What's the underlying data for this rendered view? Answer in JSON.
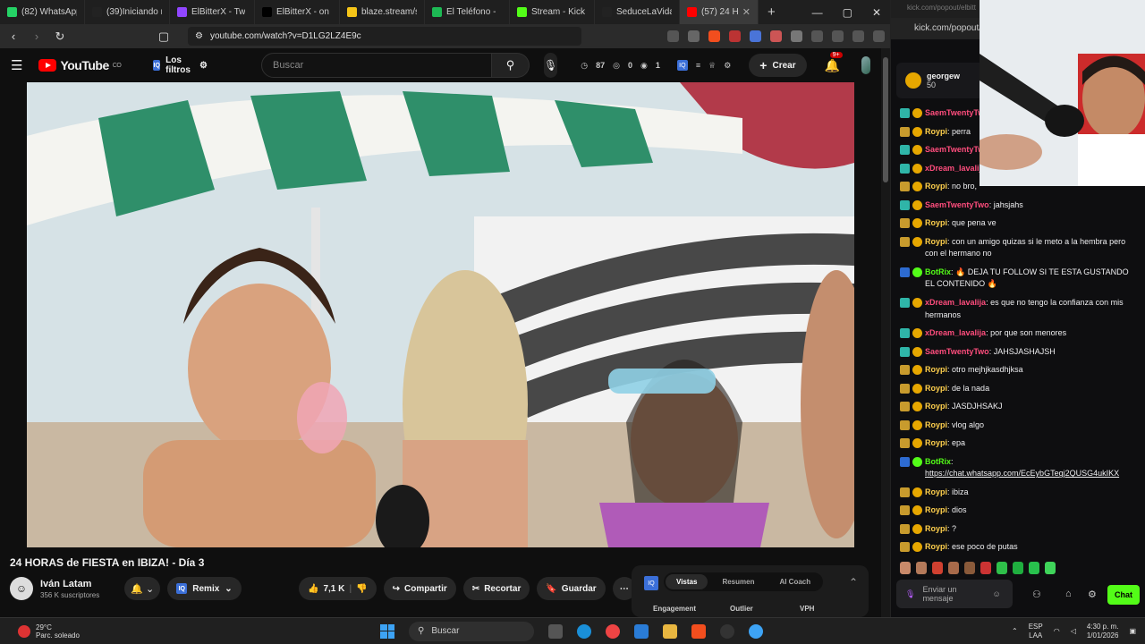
{
  "browser": {
    "tabs": [
      {
        "label": "(82) WhatsApp",
        "color": "#25d366",
        "active": false
      },
      {
        "label": "(39)Iniciando mi",
        "color": "#222222",
        "active": false
      },
      {
        "label": "ElBitterX - Tw",
        "color": "#9146ff",
        "active": false
      },
      {
        "label": "ElBitterX - on X",
        "color": "#000000",
        "active": false
      },
      {
        "label": "blaze.stream/stre",
        "color": "#f5c518",
        "active": false
      },
      {
        "label": "El Teléfono -",
        "color": "#1db954",
        "active": false
      },
      {
        "label": "Stream - Kick",
        "color": "#53fc18",
        "active": false
      },
      {
        "label": "SeduceLaVida (@",
        "color": "#222222",
        "active": false
      },
      {
        "label": "(57) 24 H",
        "color": "#ff0000",
        "active": true
      }
    ],
    "new_tab": "+",
    "url": "youtube.com/watch?v=D1LG2LZ4E9c"
  },
  "youtube": {
    "logo_text": "YouTube",
    "logo_sup": "CO",
    "filters_label": "Los filtros",
    "search_placeholder": "Buscar",
    "stats": [
      "87",
      "0",
      "1"
    ],
    "create_label": "Crear",
    "notif_badge": "9+",
    "video": {
      "title": "24 HORAS de FIESTA en IBIZA! - Día 3",
      "channel": "Iván Latam",
      "subscribers": "356 K suscriptores",
      "likes": "7,1 K",
      "remix_label": "Remix",
      "share_label": "Compartir",
      "clip_label": "Recortar",
      "save_label": "Guardar"
    },
    "iq_panel": {
      "tabs": [
        "Vistas",
        "Resumen",
        "AI Coach"
      ],
      "active_tab": "Vistas",
      "columns": [
        "Engagement",
        "Outlier",
        "VPH"
      ]
    }
  },
  "kick": {
    "url_faint": "kick.com/popout/elbitt",
    "url": "kick.com/popout/",
    "pinned_user": "georgew",
    "pinned_amount": "50",
    "messages": [
      {
        "user": "SaemTwentyTwo",
        "text": "",
        "color": "#ff4d7d"
      },
      {
        "user": "Roypi",
        "text": "perra",
        "color": "#ffd04d"
      },
      {
        "user": "SaemTwentyTwo",
        "text": "",
        "color": "#ff4d7d"
      },
      {
        "user": "xDream_lavalija",
        "text": "",
        "color": "#ff4d7d"
      },
      {
        "user": "Roypi",
        "text": "no bro,",
        "color": "#ffd04d"
      },
      {
        "user": "SaemTwentyTwo",
        "text": "jahsjahs",
        "color": "#ff4d7d"
      },
      {
        "user": "Roypi",
        "text": "que pena ve",
        "color": "#ffd04d"
      },
      {
        "user": "Roypi",
        "text": "con un amigo quizas si le meto a la hembra pero con el hermano no",
        "color": "#ffd04d"
      },
      {
        "user": "BotRix",
        "text": "🔥 DEJA TU FOLLOW SI TE ESTA GUSTANDO EL CONTENIDO 🔥",
        "color": "#53fc18"
      },
      {
        "user": "xDream_lavalija",
        "text": "es que no tengo la confianza con mis hermanos",
        "color": "#ff4d7d"
      },
      {
        "user": "xDream_lavalija",
        "text": "por que son menores",
        "color": "#ff4d7d"
      },
      {
        "user": "SaemTwentyTwo",
        "text": "JAHSJASHAJSH",
        "color": "#ff4d7d"
      },
      {
        "user": "Roypi",
        "text": "otro mejhjkasdhjksa",
        "color": "#ffd04d"
      },
      {
        "user": "Roypi",
        "text": "de la nada",
        "color": "#ffd04d"
      },
      {
        "user": "Roypi",
        "text": "JASDJHSAKJ",
        "color": "#ffd04d"
      },
      {
        "user": "Roypi",
        "text": "vlog algo",
        "color": "#ffd04d"
      },
      {
        "user": "Roypi",
        "text": "epa",
        "color": "#ffd04d"
      },
      {
        "user": "BotRix",
        "text": "https://chat.whatsapp.com/EcEybGTegj2QUSG4ukIKX",
        "color": "#53fc18"
      },
      {
        "user": "Roypi",
        "text": "ibiza",
        "color": "#ffd04d"
      },
      {
        "user": "Roypi",
        "text": "dios",
        "color": "#ffd04d"
      },
      {
        "user": "Roypi",
        "text": "?",
        "color": "#ffd04d"
      },
      {
        "user": "Roypi",
        "text": "ese poco de putas",
        "color": "#ffd04d"
      }
    ],
    "input_placeholder": "Enviar un mensaje",
    "chat_button": "Chat"
  },
  "taskbar": {
    "weather_temp": "29°C",
    "weather_desc": "Parc. soleado",
    "search_label": "Buscar",
    "lang_top": "ESP",
    "lang_bottom": "LAA",
    "time": "4:30 p. m.",
    "date": "1/01/2026"
  }
}
